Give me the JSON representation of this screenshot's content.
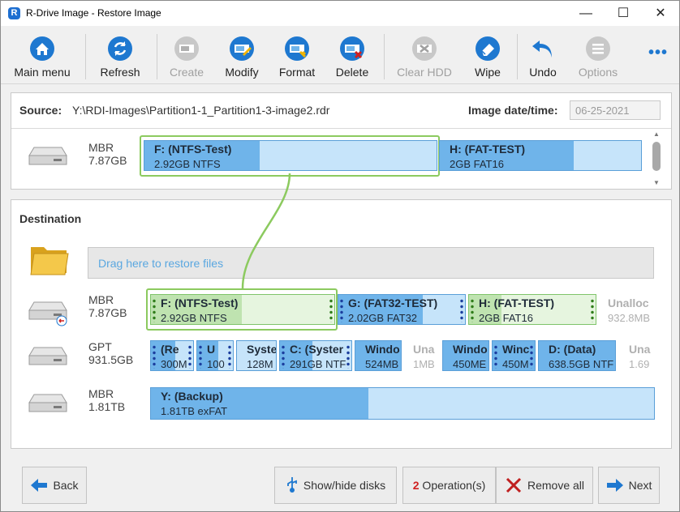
{
  "window": {
    "title": "R-Drive Image - Restore Image",
    "logo_letter": "R"
  },
  "toolbar": {
    "main_menu": "Main menu",
    "refresh": "Refresh",
    "create": "Create",
    "modify": "Modify",
    "format": "Format",
    "delete": "Delete",
    "clear_hdd": "Clear HDD",
    "wipe": "Wipe",
    "undo": "Undo",
    "options": "Options",
    "more": "•••"
  },
  "source": {
    "label": "Source:",
    "path": "Y:\\RDI-Images\\Partition1-1_Partition1-3-image2.rdr",
    "date_label": "Image date/time:",
    "date_value": "06-25-2021",
    "disk": {
      "type": "MBR",
      "size": "7.87GB"
    },
    "partitions": [
      {
        "name": "F: (NTFS-Test)",
        "info": "2.92GB NTFS",
        "used": 0.4
      },
      {
        "name": "H: (FAT-TEST)",
        "info": "2GB FAT16",
        "used": 0.66
      }
    ]
  },
  "destination": {
    "title": "Destination",
    "dropzone": "Drag here to restore files",
    "disks": [
      {
        "type": "MBR",
        "size": "7.87GB",
        "partitions": [
          {
            "name": "F: (NTFS-Test)",
            "info": "2.92GB NTFS",
            "used": 0.49
          },
          {
            "name": "G: (FAT32-TEST)",
            "info": "2.02GB FAT32",
            "used": 0.66
          },
          {
            "name": "H: (FAT-TEST)",
            "info": "2GB FAT16",
            "used": 0.25
          },
          {
            "name": "Unalloc",
            "info": "932.8MB"
          }
        ]
      },
      {
        "type": "GPT",
        "size": "931.5GB",
        "partitions": [
          {
            "name": "(Re",
            "info": "300M"
          },
          {
            "name": "U",
            "info": "100"
          },
          {
            "name": "Syste",
            "info": "128M"
          },
          {
            "name": "C: (Syster",
            "info": "291GB NTF"
          },
          {
            "name": "Windo",
            "info": "524MB"
          },
          {
            "name": "Una",
            "info": "1MB"
          },
          {
            "name": "Windo",
            "info": "450ME"
          },
          {
            "name": "Winc",
            "info": "450M"
          },
          {
            "name": "D: (Data)",
            "info": "638.5GB NTF"
          },
          {
            "name": "Una",
            "info": "1.69"
          }
        ]
      },
      {
        "type": "MBR",
        "size": "1.81TB",
        "partitions": [
          {
            "name": "Y: (Backup)",
            "info": "1.81TB exFAT",
            "used": 0.43
          }
        ]
      }
    ]
  },
  "bottom": {
    "back": "Back",
    "show_hide": "Show/hide disks",
    "operations_count": "2",
    "operations_label": " Operation(s)",
    "remove_all": "Remove all",
    "next": "Next"
  },
  "colors": {
    "accent": "#1e78d0",
    "partition_fill": "#6fb4ea",
    "partition_bg": "#c6e4fa",
    "selected": "#8cca5f"
  }
}
